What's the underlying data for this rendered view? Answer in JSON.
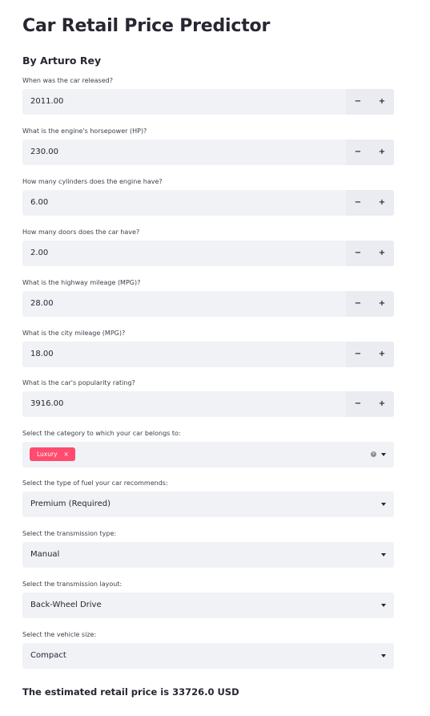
{
  "header": {
    "title": "Car Retail Price Predictor",
    "author": "By Arturo Rey"
  },
  "number_inputs": [
    {
      "label": "When was the car released?",
      "value": "2011.00",
      "minus": "−",
      "plus": "+"
    },
    {
      "label": "What is the engine's horsepower (HP)?",
      "value": "230.00",
      "minus": "−",
      "plus": "+"
    },
    {
      "label": "How many cylinders does the engine have?",
      "value": "6.00",
      "minus": "−",
      "plus": "+"
    },
    {
      "label": "How many doors does the car have?",
      "value": "2.00",
      "minus": "−",
      "plus": "+"
    },
    {
      "label": "What is the highway mileage (MPG)?",
      "value": "28.00",
      "minus": "−",
      "plus": "+"
    },
    {
      "label": "What is the city mileage (MPG)?",
      "value": "18.00",
      "minus": "−",
      "plus": "+"
    },
    {
      "label": "What is the car's popularity rating?",
      "value": "3916.00",
      "minus": "−",
      "plus": "+"
    }
  ],
  "category": {
    "label": "Select the category to which your car belongs to:",
    "tag": "Luxury",
    "tag_remove": "×",
    "clear_symbol": "×"
  },
  "selects": [
    {
      "label": "Select the type of fuel your car recommends:",
      "value": "Premium (Required)"
    },
    {
      "label": "Select the transmission type:",
      "value": "Manual"
    },
    {
      "label": "Select the transmission layout:",
      "value": "Back-Wheel Drive"
    },
    {
      "label": "Select the vehicle size:",
      "value": "Compact"
    }
  ],
  "result": {
    "text": "The estimated retail price is 33726.0 USD"
  },
  "colors": {
    "accent": "#ff4b6e",
    "input_bg": "#f0f2f6",
    "text": "#262730"
  }
}
